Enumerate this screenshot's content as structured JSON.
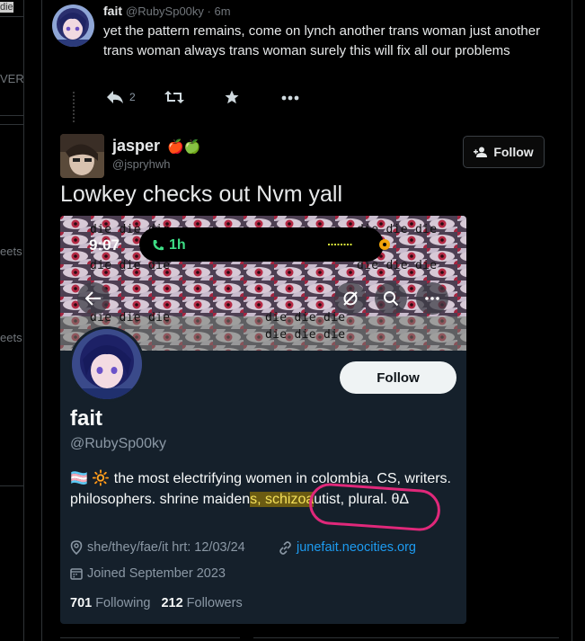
{
  "sidebar": {
    "stubs": [
      "die",
      "VERS",
      "eets",
      "eets"
    ]
  },
  "tweet1": {
    "name": "fait",
    "handle": "@RubySp00ky",
    "time": "· 6m",
    "text": "yet the pattern remains, come on lynch another trans woman just another trans woman always trans woman surely this will fix all our problems",
    "reply_count": "2",
    "icons": [
      "reply-icon",
      "retweet-icon",
      "star-icon",
      "more-icon"
    ]
  },
  "tweet2": {
    "name": "jasper",
    "emoji": "🍎🍏",
    "handle": "@jspryhwh",
    "follow_label": "Follow",
    "text": "Lowkey checks out Nvm yall"
  },
  "embed": {
    "status_time": "9:07",
    "call_duration": "1h",
    "banner_text": "die die die",
    "profile": {
      "follow_label": "Follow",
      "name": "fait",
      "handle": "@RubySp00ky",
      "bio_emoji": "🏳️‍⚧️ 🔆",
      "bio_pre": " the most electrifying women in colombia. CS, writers. philosophers. shrine maiden",
      "bio_hl": "s, schizoa",
      "bio_post": "utist, plural. θΔ",
      "pronouns": "she/they/fae/it hrt: 12/03/24",
      "link": "junefait.neocities.org",
      "joined": "Joined September 2023",
      "following_count": "701",
      "following_label": "Following",
      "followers_count": "212",
      "followers_label": "Followers"
    }
  },
  "colors": {
    "accent": "#1d9bf0",
    "highlight": "#f5e15a",
    "marker": "#e0287a"
  }
}
